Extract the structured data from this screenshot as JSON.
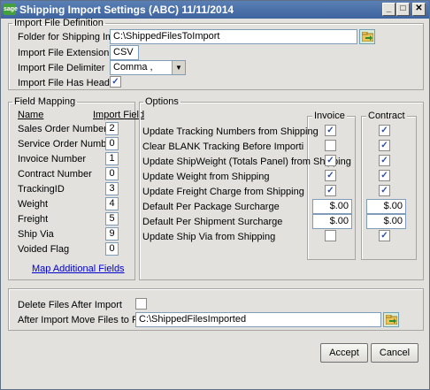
{
  "window": {
    "title": "Shipping Import Settings (ABC) 11/11/2014",
    "logo_text": "sage",
    "min_icon": "minimize-icon",
    "max_icon": "maximize-icon",
    "close_icon": "close-icon"
  },
  "import_def": {
    "legend": "Import File Definition",
    "folder_label": "Folder for Shipping Import",
    "folder_value": "C:\\ShippedFilesToImport",
    "ext_label": "Import File Extension",
    "ext_value": "CSV",
    "delim_label": "Import File Delimiter",
    "delim_value": "Comma  ,",
    "header_label": "Import File Has Header",
    "header_checked": "✓"
  },
  "field_mapping": {
    "legend": "Field Mapping",
    "col_name": "Name",
    "col_field": "Import Field",
    "rows": [
      {
        "name": "Sales Order Number",
        "value": "2"
      },
      {
        "name": "Service Order Number",
        "value": "0"
      },
      {
        "name": "Invoice Number",
        "value": "1"
      },
      {
        "name": "Contract Number",
        "value": "0"
      },
      {
        "name": "TrackingID",
        "value": "3"
      },
      {
        "name": "Weight",
        "value": "4"
      },
      {
        "name": "Freight",
        "value": "5"
      },
      {
        "name": "Ship Via",
        "value": "9"
      },
      {
        "name": "Voided Flag",
        "value": "0"
      }
    ],
    "map_link": "Map Additional Fields"
  },
  "options": {
    "legend": "Options",
    "invoice_header": "Invoice",
    "contract_header": "Contract",
    "rows": [
      {
        "label": "Update Tracking Numbers from Shipping",
        "invoice": "✓",
        "contract": "✓"
      },
      {
        "label": "Clear BLANK Tracking Before Importi",
        "invoice": "",
        "contract": "✓"
      },
      {
        "label": "Update ShipWeight (Totals Panel) from Shipping",
        "invoice": "✓",
        "contract": "✓"
      },
      {
        "label": "Update Weight from Shipping",
        "invoice": "✓",
        "contract": "✓"
      },
      {
        "label": "Update Freight Charge from Shipping",
        "invoice": "✓",
        "contract": "✓"
      },
      {
        "label": "Default Per Package Surcharge",
        "invoice_amt": "$.00",
        "contract_amt": "$.00"
      },
      {
        "label": "Default Per Shipment Surcharge",
        "invoice_amt": "$.00",
        "contract_amt": "$.00"
      },
      {
        "label": "Update Ship Via from Shipping",
        "invoice": "",
        "contract": "✓"
      }
    ]
  },
  "after_import": {
    "delete_label": "Delete Files After Import",
    "delete_checked": "",
    "move_label": "After Import Move Files to Folder",
    "move_value": "C:\\ShippedFilesImported"
  },
  "buttons": {
    "accept": "Accept",
    "cancel": "Cancel"
  }
}
